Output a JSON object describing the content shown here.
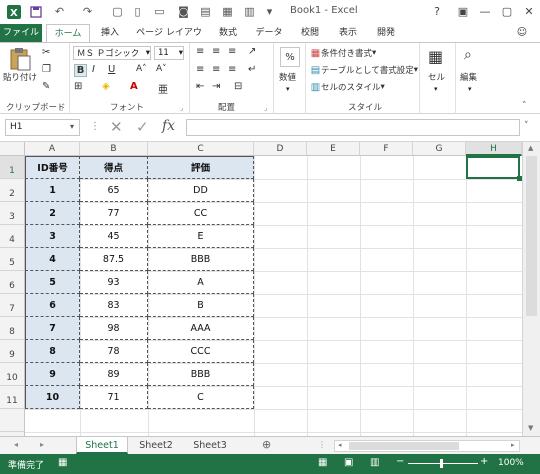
{
  "window": {
    "title": "Book1 - Excel"
  },
  "tabs": [
    "ファイル",
    "ホーム",
    "挿入",
    "ページ レイアウト",
    "数式",
    "データ",
    "校閲",
    "表示",
    "開発"
  ],
  "ribbon": {
    "clipboard": {
      "paste_label": "貼り付け",
      "group_label": "クリップボード"
    },
    "font": {
      "font_name": "ＭＳ Ｐゴシック",
      "font_size": "11",
      "group_label": "フォント",
      "bold": "B",
      "italic": "I",
      "underline": "U"
    },
    "alignment": {
      "group_label": "配置"
    },
    "number": {
      "label": "数値",
      "percent": "%"
    },
    "styles": {
      "conditional": "条件付き書式",
      "table": "テーブルとして書式設定",
      "cell_style": "セルのスタイル",
      "group_label": "スタイル"
    },
    "cells": {
      "label": "セル"
    },
    "editing": {
      "label": "編集"
    }
  },
  "formula_bar": {
    "name_box": "H1",
    "formula": ""
  },
  "columns": [
    "A",
    "B",
    "C",
    "D",
    "E",
    "F",
    "G",
    "H"
  ],
  "rows": [
    "1",
    "2",
    "3",
    "4",
    "5",
    "6",
    "7",
    "8",
    "9",
    "10",
    "11"
  ],
  "table": {
    "headers": [
      "ID番号",
      "得点",
      "評価"
    ],
    "rows": [
      [
        "1",
        "65",
        "DD"
      ],
      [
        "2",
        "77",
        "CC"
      ],
      [
        "3",
        "45",
        "E"
      ],
      [
        "4",
        "87.5",
        "BBB"
      ],
      [
        "5",
        "93",
        "A"
      ],
      [
        "6",
        "83",
        "B"
      ],
      [
        "7",
        "98",
        "AAA"
      ],
      [
        "8",
        "78",
        "CCC"
      ],
      [
        "9",
        "89",
        "BBB"
      ],
      [
        "10",
        "71",
        "C"
      ]
    ]
  },
  "sheets": [
    "Sheet1",
    "Sheet2",
    "Sheet3"
  ],
  "active_sheet": "Sheet1",
  "status": {
    "ready": "準備完了",
    "zoom": "100%"
  },
  "colors": {
    "accent": "#217346",
    "header_fill": "#dce6f1"
  }
}
